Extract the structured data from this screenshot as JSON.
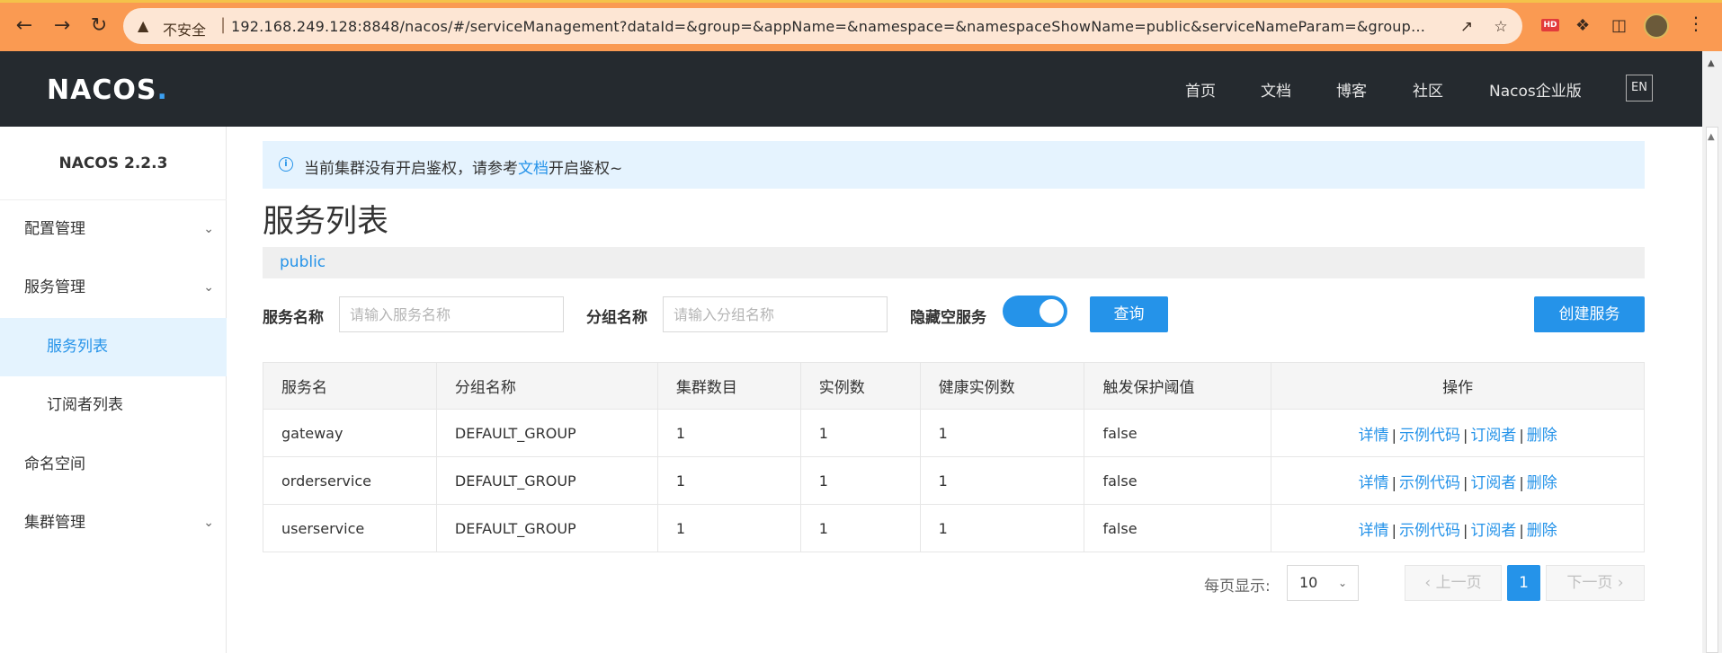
{
  "browser": {
    "insecure_label": "不安全",
    "url": "192.168.249.128:8848/nacos/#/serviceManagement?dataId=&group=&appName=&namespace=&namespaceShowName=public&serviceNameParam=&groupNamePa…",
    "hd_badge": "HD"
  },
  "header": {
    "logo_text": "NACOS",
    "nav": [
      "首页",
      "文档",
      "博客",
      "社区",
      "Nacos企业版"
    ],
    "lang_button": "EN"
  },
  "sidebar": {
    "version": "NACOS 2.2.3",
    "items": [
      {
        "label": "配置管理",
        "has_children": true
      },
      {
        "label": "服务管理",
        "has_children": true
      },
      {
        "label": "服务列表",
        "active": true
      },
      {
        "label": "订阅者列表"
      },
      {
        "label": "命名空间"
      },
      {
        "label": "集群管理",
        "has_children": true
      }
    ]
  },
  "notice": {
    "text_before": "当前集群没有开启鉴权，请参考",
    "link": "文档",
    "text_after": "开启鉴权~"
  },
  "page": {
    "title": "服务列表",
    "namespace": "public"
  },
  "filters": {
    "service_name_label": "服务名称",
    "service_name_placeholder": "请输入服务名称",
    "group_name_label": "分组名称",
    "group_name_placeholder": "请输入分组名称",
    "hide_empty_label": "隐藏空服务",
    "hide_empty_on": true,
    "query_button": "查询",
    "create_button": "创建服务"
  },
  "table": {
    "columns": [
      "服务名",
      "分组名称",
      "集群数目",
      "实例数",
      "健康实例数",
      "触发保护阈值",
      "操作"
    ],
    "rows": [
      {
        "name": "gateway",
        "group": "DEFAULT_GROUP",
        "clusters": "1",
        "instances": "1",
        "healthy": "1",
        "protect": "false"
      },
      {
        "name": "orderservice",
        "group": "DEFAULT_GROUP",
        "clusters": "1",
        "instances": "1",
        "healthy": "1",
        "protect": "false"
      },
      {
        "name": "userservice",
        "group": "DEFAULT_GROUP",
        "clusters": "1",
        "instances": "1",
        "healthy": "1",
        "protect": "false"
      }
    ],
    "actions": [
      "详情",
      "示例代码",
      "订阅者",
      "删除"
    ]
  },
  "pagination": {
    "per_page_label": "每页显示:",
    "per_page": "10",
    "prev": "上一页",
    "current": "1",
    "next": "下一页"
  },
  "colors": {
    "accent": "#2593e9",
    "header_bg": "#252a2f",
    "browser_bar": "#fa9a52"
  }
}
